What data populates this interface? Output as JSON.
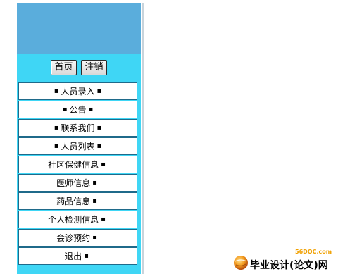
{
  "sidebar": {
    "buttons": {
      "home_label": "首页",
      "logout_label": "注销"
    },
    "menu": [
      {
        "label": "人员录入",
        "leading_bullet": true
      },
      {
        "label": "公告",
        "leading_bullet": true
      },
      {
        "label": "联系我们",
        "leading_bullet": true
      },
      {
        "label": "人员列表",
        "leading_bullet": true
      },
      {
        "label": "社区保健信息",
        "leading_bullet": false
      },
      {
        "label": "医师信息",
        "leading_bullet": false
      },
      {
        "label": "药品信息",
        "leading_bullet": false
      },
      {
        "label": "个人检测信息",
        "leading_bullet": false
      },
      {
        "label": "会诊预约",
        "leading_bullet": false
      },
      {
        "label": "退出",
        "leading_bullet": false
      }
    ],
    "bullet_char": "▪"
  },
  "watermark": {
    "url": "56DOC.com",
    "text": "毕业设计(论文)网"
  },
  "colors": {
    "sidebar_bg": "#3fd6f5",
    "header_bg": "#5aaddc",
    "menu_border": "#1f6a8a",
    "divider": "#c8d4dc",
    "watermark_url": "#f0a000"
  }
}
